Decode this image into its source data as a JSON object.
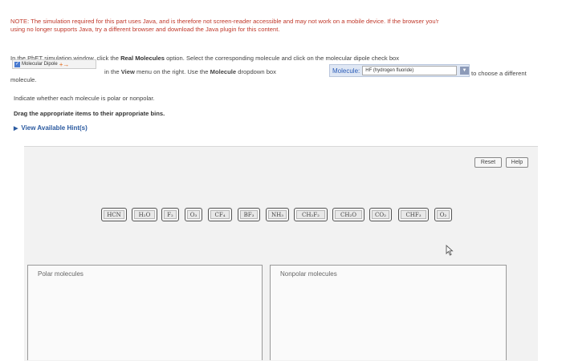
{
  "note": {
    "line1": "NOTE: The simulation required for this part uses Java, and is therefore not screen-reader accessible and may not work on a mobile device. If the browser you'r",
    "line2": "using no longer supports Java, try a different browser and download the Java plugin for this content."
  },
  "instructions": {
    "line1_prefix": "In the PhET simulation window, click the",
    "line1_bold": "Real Molecules",
    "line1_suffix": "option. Select the corresponding molecule and click on the molecular dipole check box",
    "dipole_label": "Molecular Dipole",
    "view_prefix": "in the",
    "view_bold": "View",
    "view_mid": "menu on the right. Use the",
    "molecule_bold": "Molecule",
    "view_suffix": "dropdown box",
    "dropdown_label": "Molecule:",
    "dropdown_value": "HF (hydrogen fluoride)",
    "choose_text": "to choose a different",
    "molecule_text": "molecule."
  },
  "indicate_text": "Indicate whether each molecule is polar or nonpolar.",
  "drag_text": "Drag the appropriate items to their appropriate bins.",
  "hint_text": "View Available Hint(s)",
  "buttons": {
    "reset": "Reset",
    "help": "Help"
  },
  "molecules": [
    "HCN",
    "H₂O",
    "F₂",
    "O₃",
    "CF₄",
    "BF₃",
    "NH₃",
    "CH₂F₂",
    "CH₂O",
    "CO₂",
    "CHF₃",
    "O₂"
  ],
  "bins": {
    "polar": "Polar molecules",
    "nonpolar": "Nonpolar molecules"
  },
  "colors": {
    "note": "#c0392b",
    "hint": "#2b5aa0",
    "dropdown_bg": "#dfe7f4"
  }
}
